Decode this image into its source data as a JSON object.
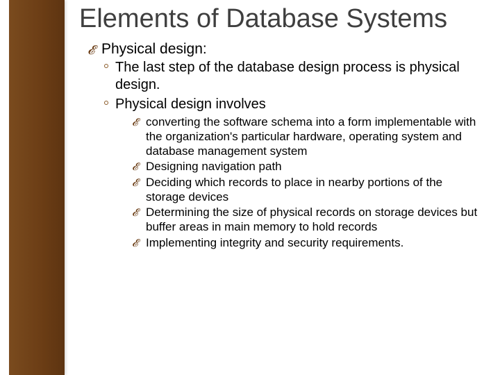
{
  "title": "Elements of Database Systems",
  "lvl1": {
    "heading": "Physical design:"
  },
  "lvl2_items": [
    "The last step of the database design process is physical design.",
    "Physical design involves"
  ],
  "lvl3_items": [
    "converting the software schema into a form implementable with the organization's particular hardware, operating system and database management system",
    "Designing navigation path",
    "Deciding which records to place in nearby portions of the storage devices",
    "Determining the size of physical records on storage devices but buffer areas in main memory to hold records",
    "Implementing integrity and security requirements."
  ]
}
